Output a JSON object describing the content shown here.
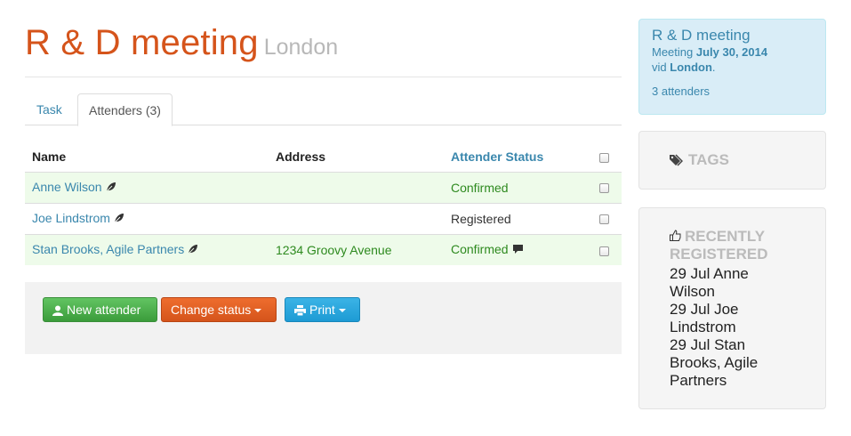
{
  "page": {
    "title": "R & D meeting",
    "subtitle": "London"
  },
  "tabs": [
    {
      "label": "Task",
      "active": false
    },
    {
      "label": "Attenders (3)",
      "active": true
    }
  ],
  "table": {
    "headers": {
      "name": "Name",
      "address": "Address",
      "status": "Attender Status"
    },
    "rows": [
      {
        "name": "Anne Wilson",
        "address": "",
        "status": "Confirmed",
        "has_comment": false
      },
      {
        "name": "Joe Lindstrom",
        "address": "",
        "status": "Registered",
        "has_comment": false
      },
      {
        "name": "Stan Brooks, Agile Partners",
        "address": "1234 Groovy Avenue",
        "status": "Confirmed",
        "has_comment": true
      }
    ]
  },
  "actions": {
    "new_attender": "New attender",
    "change_status": "Change status",
    "print": "Print"
  },
  "sidebar": {
    "info": {
      "title": "R & D meeting",
      "meeting_prefix": "Meeting",
      "date": "July 30, 2014",
      "via_prefix": "vid",
      "location": "London",
      "attenders": "3 attenders"
    },
    "tags_heading": "TAGS",
    "recent_heading": "RECENTLY REGISTERED",
    "recent": [
      "29 Jul Anne Wilson",
      "29 Jul Joe Lindstrom",
      "29 Jul Stan Brooks, Agile Partners"
    ]
  },
  "colors": {
    "brand": "#d5541b",
    "link": "#3a87ad",
    "confirmed": "#2e8a1f",
    "row_success": "#eefbea"
  }
}
